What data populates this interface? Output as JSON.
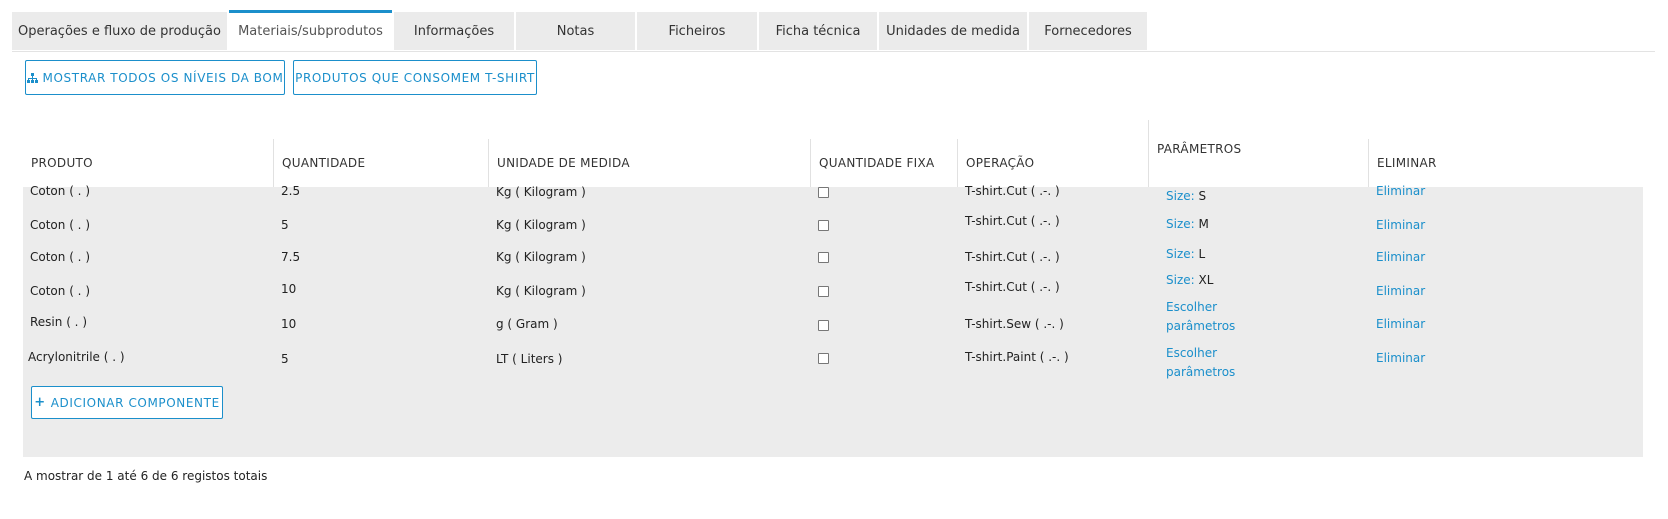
{
  "tabs": [
    {
      "label": "Operações e fluxo de produção",
      "active": false
    },
    {
      "label": "Materiais/subprodutos",
      "active": true
    },
    {
      "label": "Informações",
      "active": false
    },
    {
      "label": "Notas",
      "active": false
    },
    {
      "label": "Ficheiros",
      "active": false
    },
    {
      "label": "Ficha técnica",
      "active": false
    },
    {
      "label": "Unidades de medida",
      "active": false
    },
    {
      "label": "Fornecedores",
      "active": false
    }
  ],
  "toolbar": {
    "show_bom_label": "MOSTRAR TODOS OS NÍVEIS DA BOM",
    "consumers_label": "PRODUTOS QUE CONSOMEM T-SHIRT"
  },
  "table": {
    "headers": [
      "PRODUTO",
      "QUANTIDADE",
      "UNIDADE DE MEDIDA",
      "QUANTIDADE FIXA",
      "OPERAÇÃO",
      "PARÂMETROS",
      "ELIMINAR"
    ],
    "rows": [
      {
        "produto": "Coton ( . )",
        "quantidade": "2.5",
        "unidade": "Kg ( Kilogram )",
        "fixa": false,
        "operacao": "T-shirt.Cut ( .-. )",
        "param_key": "Size:",
        "param_value": "S",
        "param_link": "",
        "eliminar": "Eliminar"
      },
      {
        "produto": "Coton ( . )",
        "quantidade": "5",
        "unidade": "Kg ( Kilogram )",
        "fixa": false,
        "operacao": "T-shirt.Cut ( .-. )",
        "param_key": "Size:",
        "param_value": "M",
        "param_link": "",
        "eliminar": "Eliminar"
      },
      {
        "produto": "Coton ( . )",
        "quantidade": "7.5",
        "unidade": "Kg ( Kilogram )",
        "fixa": false,
        "operacao": "T-shirt.Cut ( .-. )",
        "param_key": "Size:",
        "param_value": "L",
        "param_link": "",
        "eliminar": "Eliminar"
      },
      {
        "produto": "Coton ( . )",
        "quantidade": "10",
        "unidade": "Kg ( Kilogram )",
        "fixa": false,
        "operacao": "T-shirt.Cut ( .-. )",
        "param_key": "Size:",
        "param_value": "XL",
        "param_link": "",
        "eliminar": "Eliminar"
      },
      {
        "produto": "Resin ( . )",
        "quantidade": "10",
        "unidade": "g ( Gram )",
        "fixa": false,
        "operacao": "T-shirt.Sew ( .-. )",
        "param_key": "",
        "param_value": "",
        "param_link": "Escolher parâmetros",
        "eliminar": "Eliminar"
      },
      {
        "produto": "Acrylonitrile ( . )",
        "quantidade": "5",
        "unidade": "LT ( Liters )",
        "fixa": false,
        "operacao": "T-shirt.Paint ( .-. )",
        "param_key": "",
        "param_value": "",
        "param_link": "Escolher parâmetros",
        "eliminar": "Eliminar"
      }
    ],
    "add_component_label": "ADICIONAR COMPONENTE"
  },
  "footer": {
    "text": "A mostrar de 1 até 6 de 6 registos totais"
  },
  "colors": {
    "accent": "#1b8fcb",
    "row_bg": "#ececec",
    "tab_bg": "#ebebeb"
  }
}
